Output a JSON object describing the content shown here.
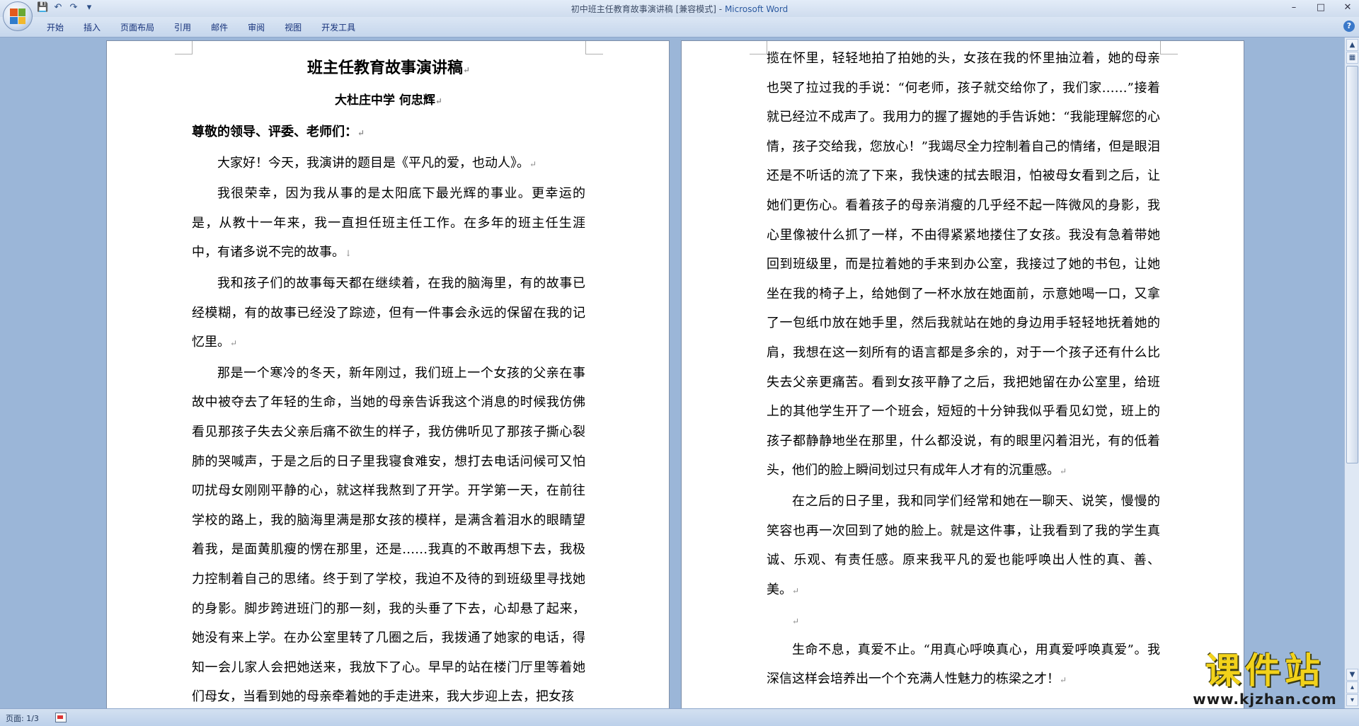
{
  "window": {
    "title_doc": "初中班主任教育故事演讲稿 [兼容模式]",
    "title_sep": " - ",
    "title_app": "Microsoft Word"
  },
  "quick_access": {
    "icons": [
      "save-icon",
      "undo-icon",
      "redo-icon",
      "customize-icon"
    ]
  },
  "ribbon": {
    "tabs": [
      "开始",
      "插入",
      "页面布局",
      "引用",
      "邮件",
      "审阅",
      "视图",
      "开发工具"
    ]
  },
  "document": {
    "title": "班主任教育故事演讲稿",
    "subtitle": "大杜庄中学   何忠辉",
    "salutation": "尊敬的领导、评委、老师们：",
    "page1_paragraphs": [
      "大家好！今天，我演讲的题目是《平凡的爱，也动人》。",
      "我很荣幸，因为我从事的是太阳底下最光辉的事业。更幸运的是，从教十一年来，我一直担任班主任工作。在多年的班主任生涯中，有诸多说不完的故事。",
      "我和孩子们的故事每天都在继续着，在我的脑海里，有的故事已经模糊，有的故事已经没了踪迹，但有一件事会永远的保留在我的记忆里。",
      "那是一个寒冷的冬天，新年刚过，我们班上一个女孩的父亲在事故中被夺去了年轻的生命，当她的母亲告诉我这个消息的时候我仿佛看见那孩子失去父亲后痛不欲生的样子，我仿佛听见了那孩子撕心裂肺的哭喊声，于是之后的日子里我寝食难安，想打去电话问候可又怕叨扰母女刚刚平静的心，就这样我熬到了开学。开学第一天，在前往学校的路上，我的脑海里满是那女孩的模样，是满含着泪水的眼睛望着我，是面黄肌瘦的愣在那里，还是……我真的不敢再想下去，我极力控制着自己的思绪。终于到了学校，我迫不及待的到班级里寻找她的身影。脚步跨进班门的那一刻，我的头垂了下去，心却悬了起来，她没有来上学。在办公室里转了几圈之后，我拨通了她家的电话，得知一会儿家人会把她送来，我放下了心。早早的站在楼门厅里等着她们母女，当看到她的母亲牵着她的手走进来，我大步迎上去，把女孩"
    ],
    "page2_paragraphs": [
      "揽在怀里，轻轻地拍了拍她的头，女孩在我的怀里抽泣着，她的母亲也哭了拉过我的手说：“何老师，孩子就交给你了，我们家……”接着就已经泣不成声了。我用力的握了握她的手告诉她：“我能理解您的心情，孩子交给我，您放心！”我竭尽全力控制着自己的情绪，但是眼泪还是不听话的流了下来，我快速的拭去眼泪，怕被母女看到之后，让她们更伤心。看着孩子的母亲消瘦的几乎经不起一阵微风的身影，我心里像被什么抓了一样，不由得紧紧地搂住了女孩。我没有急着带她回到班级里，而是拉着她的手来到办公室，我接过了她的书包，让她坐在我的椅子上，给她倒了一杯水放在她面前，示意她喝一口，又拿了一包纸巾放在她手里，然后我就站在她的身边用手轻轻地抚着她的肩，我想在这一刻所有的语言都是多余的，对于一个孩子还有什么比失去父亲更痛苦。看到女孩平静了之后，我把她留在办公室里，给班上的其他学生开了一个班会，短短的十分钟我似乎看见幻觉，班上的孩子都静静地坐在那里，什么都没说，有的眼里闪着泪光，有的低着头，他们的脸上瞬间划过只有成年人才有的沉重感。",
      "在之后的日子里，我和同学们经常和她在一聊天、说笑，慢慢的笑容也再一次回到了她的脸上。就是这件事，让我看到了我的学生真诚、乐观、有责任感。原来我平凡的爱也能呼唤出人性的真、善、美。",
      "生命不息，真爱不止。“用真心呼唤真心，用真爱呼唤真爱”。我深信这样会培养出一个个充满人性魅力的栋梁之才！"
    ]
  },
  "statusbar": {
    "page_info": "页面: 1/3"
  },
  "watermark": {
    "text": "课件站",
    "url": "www.kjzhan.com"
  }
}
